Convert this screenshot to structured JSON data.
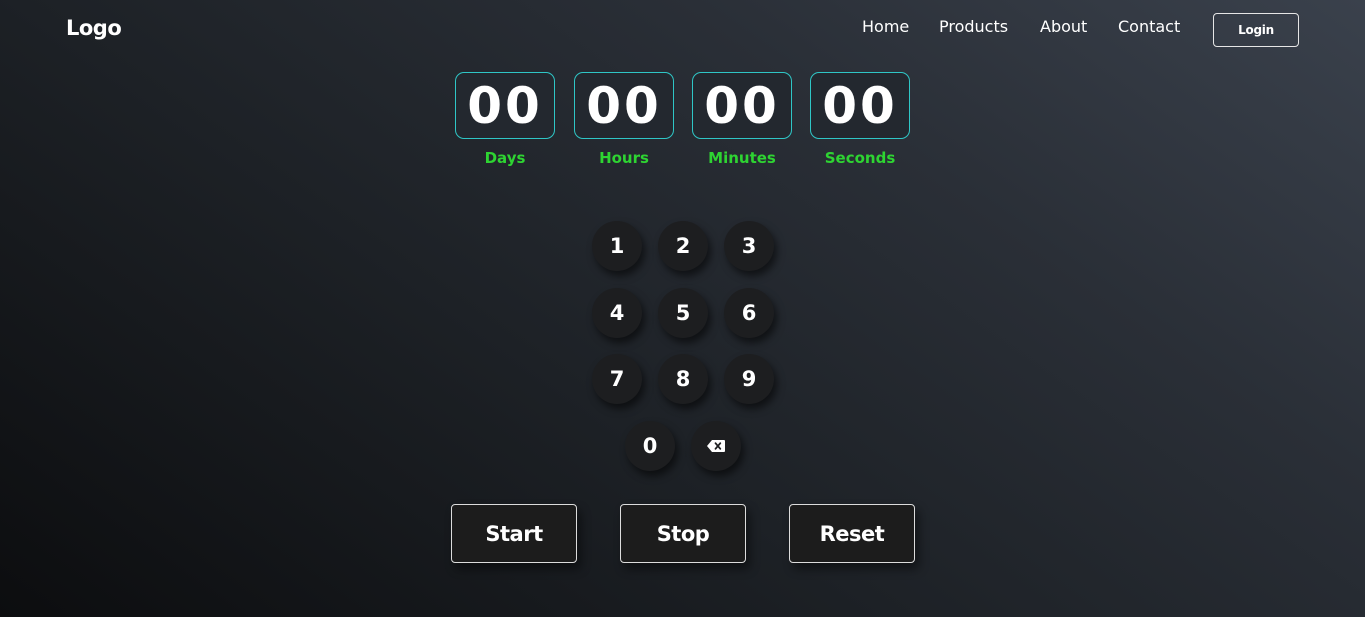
{
  "header": {
    "logo": "Logo",
    "nav": [
      "Home",
      "Products",
      "About",
      "Contact"
    ],
    "login_label": "Login"
  },
  "timer": {
    "units": [
      {
        "value": "00",
        "label": "Days"
      },
      {
        "value": "00",
        "label": "Hours"
      },
      {
        "value": "00",
        "label": "Minutes"
      },
      {
        "value": "00",
        "label": "Seconds"
      }
    ]
  },
  "keypad": {
    "keys": [
      "1",
      "2",
      "3",
      "4",
      "5",
      "6",
      "7",
      "8",
      "9",
      "0"
    ],
    "backspace_icon": "backspace-icon"
  },
  "actions": {
    "start": "Start",
    "stop": "Stop",
    "reset": "Reset"
  },
  "colors": {
    "accent_border": "#2fc6c6",
    "label_green": "#2ed432"
  }
}
